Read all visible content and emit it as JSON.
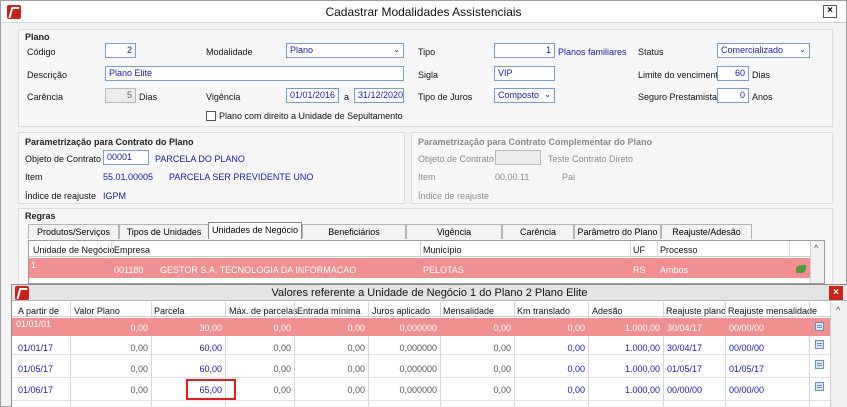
{
  "window": {
    "title": "Cadastrar Modalidades Assistenciais",
    "close_label": "×"
  },
  "plano": {
    "section_label": "Plano",
    "codigo_label": "Código",
    "codigo_value": "2",
    "modalidade_label": "Modalidade",
    "modalidade_value": "Plano",
    "tipo_label": "Tipo",
    "tipo_value": "1",
    "tipo_desc": "Planos familiares",
    "status_label": "Status",
    "status_value": "Comercializado",
    "descricao_label": "Descrição",
    "descricao_value": "Plano Elite",
    "sigla_label": "Sigla",
    "sigla_value": "VIP",
    "limite_label": "Limite do vencimento",
    "limite_value": "60",
    "limite_unit": "Dias",
    "carencia_label": "Carência",
    "carencia_value": "5",
    "carencia_unit": "Dias",
    "vigencia_label": "Vigência",
    "vigencia_from": "01/01/2016",
    "vigencia_sep": "a",
    "vigencia_to": "31/12/2020",
    "juros_label": "Tipo de Juros",
    "juros_value": "Composto",
    "seguro_label": "Seguro Prestamista",
    "seguro_value": "0",
    "seguro_unit": "Anos",
    "sepultamento_label": "Plano com direito a Unidade de Sepultamento",
    "arrow": "⌄"
  },
  "param_plano": {
    "section_label": "Parametrização para Contrato do Plano",
    "objeto_label": "Objeto de Contrato",
    "objeto_value": "00001",
    "objeto_desc": "PARCELA DO PLANO",
    "item_label": "Item",
    "item_value": "55.01.00005",
    "item_desc": "PARCELA SER PREVIDENTE UNO",
    "indice_label": "Índice de reajuste",
    "indice_value": "IGPM"
  },
  "param_compl": {
    "section_label": "Parametrização para Contrato Complementar do Plano",
    "objeto_label": "Objeto de Contrato",
    "objeto_desc": "Teste Contrato Direto",
    "item_label": "Item",
    "item_value": "00.00.11",
    "item_desc": "Pai",
    "indice_label": "Índice de reajuste"
  },
  "regras": {
    "section_label": "Regras",
    "tabs": [
      "Produtos/Serviços",
      "Tipos de Unidades",
      "Unidades de Negócio",
      "Beneficiários",
      "Vigência",
      "Carência",
      "Parâmetro do Plano",
      "Reajuste/Adesão"
    ],
    "columns": [
      "Unidade de Negócio",
      "Empresa",
      "Município",
      "UF",
      "Processo"
    ],
    "row": {
      "unidade": "1",
      "empresa_code": "001180",
      "empresa_name": "GESTOR S.A. TECNOLOGIA DA INFORMACAO",
      "municipio": "PELOTAS",
      "uf": "RS",
      "processo": "Ambos"
    },
    "scroll_up": "^"
  },
  "valores": {
    "title": "Valores referente a Unidade de Negócio 1   do Plano 2 Plano Elite",
    "close_label": "×",
    "columns": [
      "A partir de",
      "Valor Plano",
      "Parcela",
      "Máx. de parcelas",
      "Entrada mínima",
      "Juros aplicado",
      "Mensalidade",
      "Km translado",
      "Adesão",
      "Reajuste plano",
      "Reajuste mensalidade"
    ],
    "rows": [
      [
        "01/01/01",
        "0,00",
        "30,00",
        "0,00",
        "0,00",
        "0,000000",
        "0,00",
        "0,00",
        "1.000,00",
        "30/04/17",
        "00/00/00"
      ],
      [
        "01/01/17",
        "0,00",
        "60,00",
        "0,00",
        "0,00",
        "0,000000",
        "0,00",
        "0,00",
        "1.000,00",
        "30/04/17",
        "00/00/00"
      ],
      [
        "01/05/17",
        "0,00",
        "60,00",
        "0,00",
        "0,00",
        "0,000000",
        "0,00",
        "0,00",
        "1.000,00",
        "01/05/17",
        "01/05/17"
      ],
      [
        "01/06/17",
        "0,00",
        "65,00",
        "0,00",
        "0,00",
        "0,000000",
        "0,00",
        "0,00",
        "1.000,00",
        "00/00/00",
        "00/00/00"
      ]
    ],
    "scroll_up": "^"
  }
}
